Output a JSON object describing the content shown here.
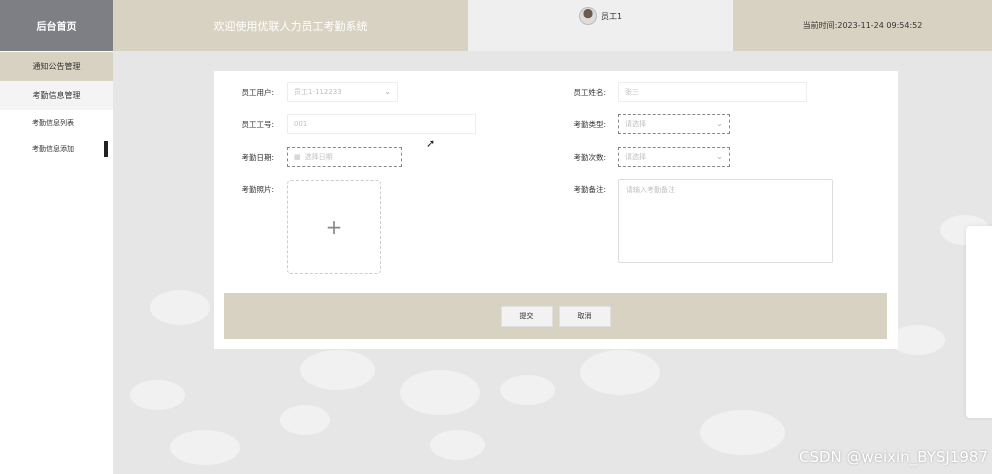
{
  "header": {
    "logo": "后台首页",
    "welcome": "欢迎使用优联人力员工考勤系统",
    "username": "员工1",
    "time_label": "当前时间:",
    "time_value": "2023-11-24 09:54:52"
  },
  "sidebar": {
    "items": [
      {
        "label": "通知公告管理"
      },
      {
        "label": "考勤信息管理"
      }
    ],
    "subitems": [
      {
        "label": "考勤信息列表"
      },
      {
        "label": "考勤信息添加"
      }
    ]
  },
  "form": {
    "employee_user_label": "员工用户:",
    "employee_user_value": "员工1-112233",
    "employee_name_label": "员工姓名:",
    "employee_name_value": "张三",
    "employee_no_label": "员工工号:",
    "employee_no_value": "001",
    "attendance_type_label": "考勤类型:",
    "attendance_type_placeholder": "请选择",
    "attendance_date_label": "考勤日期:",
    "attendance_date_placeholder": "选择日期",
    "attendance_count_label": "考勤次数:",
    "attendance_count_placeholder": "请选择",
    "photo_label": "考勤照片:",
    "note_label": "考勤备注:",
    "note_placeholder": "请输入考勤备注",
    "submit_label": "提交",
    "cancel_label": "取消"
  },
  "watermark": "CSDN @weixin_BYSJ1987",
  "colors": {
    "accent": "#d8d2c2",
    "logo_bg": "#7d7f85",
    "background": "#e6e6e6"
  }
}
